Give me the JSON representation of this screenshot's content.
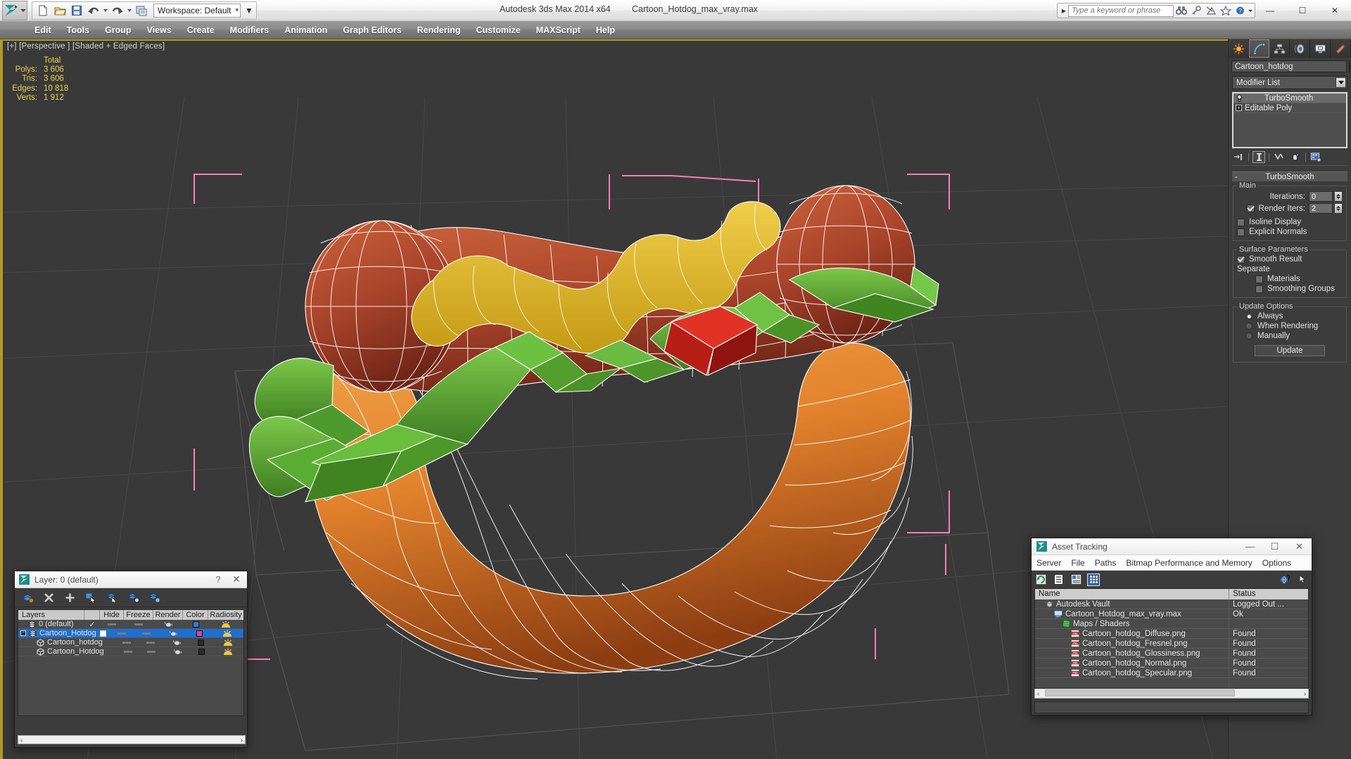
{
  "titlebar": {
    "app_title": "Autodesk 3ds Max  2014 x64",
    "file_title": "Cartoon_Hotdog_max_vray.max",
    "workspace_label": "Workspace: Default",
    "quick_access": [
      {
        "name": "new-file-icon",
        "label": "New"
      },
      {
        "name": "open-file-icon",
        "label": "Open"
      },
      {
        "name": "save-file-icon",
        "label": "Save"
      },
      {
        "name": "undo-icon",
        "label": "Undo"
      },
      {
        "name": "redo-icon",
        "label": "Redo"
      },
      {
        "name": "project-folder-icon",
        "label": "Set Project Folder"
      }
    ],
    "window_buttons": {
      "minimize": "—",
      "maximize": "☐",
      "close": "✕"
    }
  },
  "infocenter": {
    "placeholder": "Type a keyword or phrase",
    "value": "",
    "icons": [
      "search-binoculars-icon",
      "subscription-key-icon",
      "communication-center-icon",
      "favorites-star-icon",
      "help-question-icon"
    ]
  },
  "menubar": {
    "items": [
      "Edit",
      "Tools",
      "Group",
      "Views",
      "Create",
      "Modifiers",
      "Animation",
      "Graph Editors",
      "Rendering",
      "Customize",
      "MAXScript",
      "Help"
    ]
  },
  "viewport": {
    "label": "[+] [Perspective ] [Shaded + Edged Faces]",
    "stats": {
      "header": "Total",
      "rows": [
        {
          "label": "Polys:",
          "value": "3 606"
        },
        {
          "label": "Tris:",
          "value": "3 606"
        },
        {
          "label": "Edges:",
          "value": "10 818"
        },
        {
          "label": "Verts:",
          "value": "1 912"
        }
      ]
    },
    "colors": {
      "background": "#393939",
      "grid": "#4a4a4a",
      "stats_text": "#e8d44d",
      "active_border": "#b09a28",
      "selection_bracket": "#ff7fb4",
      "bun": "#e0822e",
      "sausage": "#b0462c",
      "mustard": "#e0b52a",
      "relish": "#5aa83a",
      "ketchup": "#e02020",
      "wireframe": "#ffffff"
    }
  },
  "command_panel": {
    "tabs": [
      {
        "name": "create-tab",
        "icon": "create-star-icon",
        "active": false
      },
      {
        "name": "modify-tab",
        "icon": "modify-curve-icon",
        "active": true
      },
      {
        "name": "hierarchy-tab",
        "icon": "hierarchy-icon",
        "active": false
      },
      {
        "name": "motion-tab",
        "icon": "motion-wheel-icon",
        "active": false
      },
      {
        "name": "display-tab",
        "icon": "display-monitor-icon",
        "active": false
      },
      {
        "name": "utilities-tab",
        "icon": "utilities-hammer-icon",
        "active": false
      }
    ],
    "object_name": "Cartoon_hotdog",
    "modifier_list_label": "Modifier List",
    "modifier_stack": [
      {
        "name": "TurboSmooth",
        "icon": "lightbulb-icon",
        "selected": true,
        "expandable": false
      },
      {
        "name": "Editable Poly",
        "icon": "plus-box-icon",
        "selected": false,
        "expandable": true
      }
    ],
    "stack_buttons": [
      {
        "name": "pin-stack-button",
        "icon": "pin-icon"
      },
      {
        "name": "show-end-result-button",
        "icon": "show-result-icon",
        "active": true
      },
      {
        "name": "make-unique-button",
        "icon": "make-unique-icon"
      },
      {
        "name": "remove-modifier-button",
        "icon": "trash-icon"
      },
      {
        "name": "configure-modifier-sets-button",
        "icon": "configure-icon"
      }
    ],
    "rollout": {
      "title": "TurboSmooth",
      "minus": "-",
      "groups": [
        {
          "title": "Main",
          "fields": [
            {
              "type": "spinner",
              "label": "Iterations:",
              "value": "0"
            },
            {
              "type": "spinner_check",
              "label": "Render Iters:",
              "value": "2",
              "checked": true
            },
            {
              "type": "check",
              "label": "Isoline Display",
              "checked": false
            },
            {
              "type": "check",
              "label": "Explicit Normals",
              "checked": false
            }
          ]
        },
        {
          "title": "Surface Parameters",
          "fields": [
            {
              "type": "check",
              "label": "Smooth Result",
              "checked": true
            },
            {
              "type": "text",
              "label": "Separate"
            },
            {
              "type": "check_indent",
              "label": "Materials",
              "checked": false
            },
            {
              "type": "check_indent",
              "label": "Smoothing Groups",
              "checked": false
            }
          ]
        },
        {
          "title": "Update Options",
          "fields": [
            {
              "type": "radio",
              "label": "Always",
              "checked": true
            },
            {
              "type": "radio",
              "label": "When Rendering",
              "checked": false
            },
            {
              "type": "radio",
              "label": "Manually",
              "checked": false
            },
            {
              "type": "button",
              "label": "Update"
            }
          ]
        }
      ]
    }
  },
  "layer_dialog": {
    "title": "Layer: 0 (default)",
    "help_label": "?",
    "close_label": "✕",
    "toolbar": [
      {
        "name": "new-layer-button",
        "icon": "new-layer-icon"
      },
      {
        "name": "delete-layer-button",
        "icon": "delete-x-icon"
      },
      {
        "name": "add-layer-button",
        "icon": "plus-icon"
      },
      {
        "name": "select-objects-button",
        "icon": "select-objects-icon"
      },
      {
        "name": "select-highlighted-button",
        "icon": "select-highlighted-icon"
      },
      {
        "name": "highlight-selected-button",
        "icon": "highlight-selected-icon"
      },
      {
        "name": "layer-properties-button",
        "icon": "layer-settings-icon"
      }
    ],
    "columns": [
      "Layers",
      "",
      "Hide",
      "Freeze",
      "Render",
      "Color",
      "Radiosity"
    ],
    "rows": [
      {
        "name": "0 (default)",
        "icon": "layer-icon",
        "indent": 0,
        "checked": true,
        "check_type": "tick",
        "color": "#2f7fd8",
        "selected": false,
        "expandable": false
      },
      {
        "name": "Cartoon_Hotdog",
        "icon": "layer-icon",
        "indent": 0,
        "checked": false,
        "check_type": "box",
        "color": "#e040a0",
        "selected": true,
        "expandable": true
      },
      {
        "name": "Cartoon_hotdog",
        "icon": "object-icon",
        "indent": 1,
        "checked": false,
        "check_type": "none",
        "color": "#2a2a2a",
        "selected": false,
        "expandable": false
      },
      {
        "name": "Cartoon_Hotdog",
        "icon": "object-icon",
        "indent": 1,
        "checked": false,
        "check_type": "none",
        "color": "#2a2a2a",
        "selected": false,
        "expandable": false
      }
    ],
    "scroll_left": "‹",
    "scroll_right": "›"
  },
  "asset_tracking": {
    "title": "Asset Tracking",
    "window_buttons": {
      "minimize": "—",
      "maximize": "☐",
      "close": "✕"
    },
    "menu": [
      "Server",
      "File",
      "Paths",
      "Bitmap Performance and Memory",
      "Options"
    ],
    "toolbar": [
      {
        "name": "refresh-button",
        "icon": "refresh-icon"
      },
      {
        "name": "list-view-button",
        "icon": "list-icon"
      },
      {
        "name": "detail-view-button",
        "icon": "detail-icon"
      },
      {
        "name": "grid-view-button",
        "icon": "grid-icon",
        "active": true
      },
      {
        "name": "help-web-button",
        "icon": "help-globe-icon"
      },
      {
        "name": "help-button",
        "icon": "help-arrow-icon"
      }
    ],
    "columns": [
      "Name",
      "Status"
    ],
    "rows": [
      {
        "name": "Autodesk Vault",
        "status": "Logged Out ...",
        "indent": 0,
        "icon": "vault-icon"
      },
      {
        "name": "Cartoon_Hotdog_max_vray.max",
        "status": "Ok",
        "indent": 1,
        "icon": "max-file-icon"
      },
      {
        "name": "Maps / Shaders",
        "status": "",
        "indent": 2,
        "icon": "maps-shaders-icon"
      },
      {
        "name": "Cartoon_hotdog_Diffuse.png",
        "status": "Found",
        "indent": 3,
        "icon": "png-icon"
      },
      {
        "name": "Cartoon_hotdog_Fresnel.png",
        "status": "Found",
        "indent": 3,
        "icon": "png-icon"
      },
      {
        "name": "Cartoon_hotdog_Glossiness.png",
        "status": "Found",
        "indent": 3,
        "icon": "png-icon"
      },
      {
        "name": "Cartoon_hotdog_Normal.png",
        "status": "Found",
        "indent": 3,
        "icon": "png-icon"
      },
      {
        "name": "Cartoon_hotdog_Specular.png",
        "status": "Found",
        "indent": 3,
        "icon": "png-icon"
      }
    ],
    "scroll_left": "‹",
    "scroll_right": "›",
    "status_text": ""
  }
}
